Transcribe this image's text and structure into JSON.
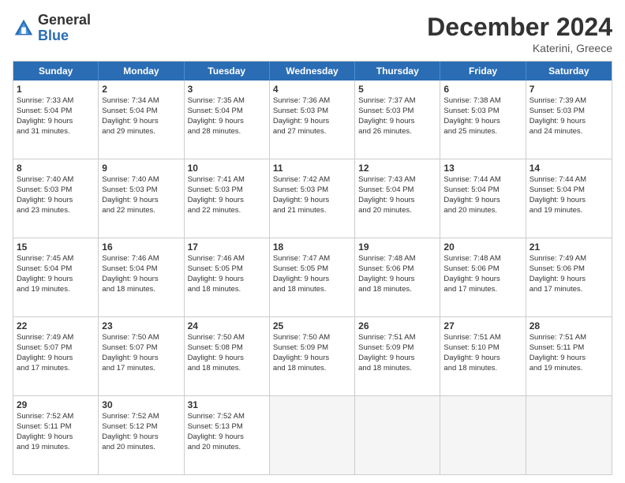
{
  "logo": {
    "general": "General",
    "blue": "Blue"
  },
  "title": "December 2024",
  "subtitle": "Katerini, Greece",
  "header_days": [
    "Sunday",
    "Monday",
    "Tuesday",
    "Wednesday",
    "Thursday",
    "Friday",
    "Saturday"
  ],
  "weeks": [
    [
      {
        "day": "1",
        "lines": [
          "Sunrise: 7:33 AM",
          "Sunset: 5:04 PM",
          "Daylight: 9 hours",
          "and 31 minutes."
        ]
      },
      {
        "day": "2",
        "lines": [
          "Sunrise: 7:34 AM",
          "Sunset: 5:04 PM",
          "Daylight: 9 hours",
          "and 29 minutes."
        ]
      },
      {
        "day": "3",
        "lines": [
          "Sunrise: 7:35 AM",
          "Sunset: 5:04 PM",
          "Daylight: 9 hours",
          "and 28 minutes."
        ]
      },
      {
        "day": "4",
        "lines": [
          "Sunrise: 7:36 AM",
          "Sunset: 5:03 PM",
          "Daylight: 9 hours",
          "and 27 minutes."
        ]
      },
      {
        "day": "5",
        "lines": [
          "Sunrise: 7:37 AM",
          "Sunset: 5:03 PM",
          "Daylight: 9 hours",
          "and 26 minutes."
        ]
      },
      {
        "day": "6",
        "lines": [
          "Sunrise: 7:38 AM",
          "Sunset: 5:03 PM",
          "Daylight: 9 hours",
          "and 25 minutes."
        ]
      },
      {
        "day": "7",
        "lines": [
          "Sunrise: 7:39 AM",
          "Sunset: 5:03 PM",
          "Daylight: 9 hours",
          "and 24 minutes."
        ]
      }
    ],
    [
      {
        "day": "8",
        "lines": [
          "Sunrise: 7:40 AM",
          "Sunset: 5:03 PM",
          "Daylight: 9 hours",
          "and 23 minutes."
        ]
      },
      {
        "day": "9",
        "lines": [
          "Sunrise: 7:40 AM",
          "Sunset: 5:03 PM",
          "Daylight: 9 hours",
          "and 22 minutes."
        ]
      },
      {
        "day": "10",
        "lines": [
          "Sunrise: 7:41 AM",
          "Sunset: 5:03 PM",
          "Daylight: 9 hours",
          "and 22 minutes."
        ]
      },
      {
        "day": "11",
        "lines": [
          "Sunrise: 7:42 AM",
          "Sunset: 5:03 PM",
          "Daylight: 9 hours",
          "and 21 minutes."
        ]
      },
      {
        "day": "12",
        "lines": [
          "Sunrise: 7:43 AM",
          "Sunset: 5:04 PM",
          "Daylight: 9 hours",
          "and 20 minutes."
        ]
      },
      {
        "day": "13",
        "lines": [
          "Sunrise: 7:44 AM",
          "Sunset: 5:04 PM",
          "Daylight: 9 hours",
          "and 20 minutes."
        ]
      },
      {
        "day": "14",
        "lines": [
          "Sunrise: 7:44 AM",
          "Sunset: 5:04 PM",
          "Daylight: 9 hours",
          "and 19 minutes."
        ]
      }
    ],
    [
      {
        "day": "15",
        "lines": [
          "Sunrise: 7:45 AM",
          "Sunset: 5:04 PM",
          "Daylight: 9 hours",
          "and 19 minutes."
        ]
      },
      {
        "day": "16",
        "lines": [
          "Sunrise: 7:46 AM",
          "Sunset: 5:04 PM",
          "Daylight: 9 hours",
          "and 18 minutes."
        ]
      },
      {
        "day": "17",
        "lines": [
          "Sunrise: 7:46 AM",
          "Sunset: 5:05 PM",
          "Daylight: 9 hours",
          "and 18 minutes."
        ]
      },
      {
        "day": "18",
        "lines": [
          "Sunrise: 7:47 AM",
          "Sunset: 5:05 PM",
          "Daylight: 9 hours",
          "and 18 minutes."
        ]
      },
      {
        "day": "19",
        "lines": [
          "Sunrise: 7:48 AM",
          "Sunset: 5:06 PM",
          "Daylight: 9 hours",
          "and 18 minutes."
        ]
      },
      {
        "day": "20",
        "lines": [
          "Sunrise: 7:48 AM",
          "Sunset: 5:06 PM",
          "Daylight: 9 hours",
          "and 17 minutes."
        ]
      },
      {
        "day": "21",
        "lines": [
          "Sunrise: 7:49 AM",
          "Sunset: 5:06 PM",
          "Daylight: 9 hours",
          "and 17 minutes."
        ]
      }
    ],
    [
      {
        "day": "22",
        "lines": [
          "Sunrise: 7:49 AM",
          "Sunset: 5:07 PM",
          "Daylight: 9 hours",
          "and 17 minutes."
        ]
      },
      {
        "day": "23",
        "lines": [
          "Sunrise: 7:50 AM",
          "Sunset: 5:07 PM",
          "Daylight: 9 hours",
          "and 17 minutes."
        ]
      },
      {
        "day": "24",
        "lines": [
          "Sunrise: 7:50 AM",
          "Sunset: 5:08 PM",
          "Daylight: 9 hours",
          "and 18 minutes."
        ]
      },
      {
        "day": "25",
        "lines": [
          "Sunrise: 7:50 AM",
          "Sunset: 5:09 PM",
          "Daylight: 9 hours",
          "and 18 minutes."
        ]
      },
      {
        "day": "26",
        "lines": [
          "Sunrise: 7:51 AM",
          "Sunset: 5:09 PM",
          "Daylight: 9 hours",
          "and 18 minutes."
        ]
      },
      {
        "day": "27",
        "lines": [
          "Sunrise: 7:51 AM",
          "Sunset: 5:10 PM",
          "Daylight: 9 hours",
          "and 18 minutes."
        ]
      },
      {
        "day": "28",
        "lines": [
          "Sunrise: 7:51 AM",
          "Sunset: 5:11 PM",
          "Daylight: 9 hours",
          "and 19 minutes."
        ]
      }
    ],
    [
      {
        "day": "29",
        "lines": [
          "Sunrise: 7:52 AM",
          "Sunset: 5:11 PM",
          "Daylight: 9 hours",
          "and 19 minutes."
        ]
      },
      {
        "day": "30",
        "lines": [
          "Sunrise: 7:52 AM",
          "Sunset: 5:12 PM",
          "Daylight: 9 hours",
          "and 20 minutes."
        ]
      },
      {
        "day": "31",
        "lines": [
          "Sunrise: 7:52 AM",
          "Sunset: 5:13 PM",
          "Daylight: 9 hours",
          "and 20 minutes."
        ]
      },
      {
        "day": "",
        "lines": []
      },
      {
        "day": "",
        "lines": []
      },
      {
        "day": "",
        "lines": []
      },
      {
        "day": "",
        "lines": []
      }
    ]
  ]
}
